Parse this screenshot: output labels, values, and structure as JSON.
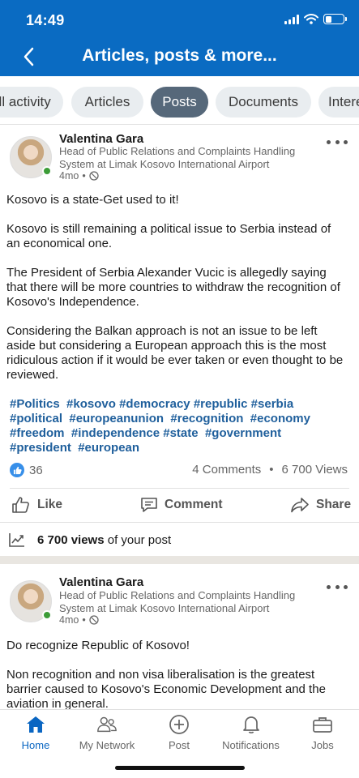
{
  "status_bar": {
    "time": "14:49"
  },
  "header": {
    "title": "Articles, posts & more..."
  },
  "filters": [
    {
      "label": "All activity",
      "active": false
    },
    {
      "label": "Articles",
      "active": false
    },
    {
      "label": "Posts",
      "active": true
    },
    {
      "label": "Documents",
      "active": false
    },
    {
      "label": "Interests",
      "active": false
    }
  ],
  "posts": [
    {
      "author": "Valentina Gara",
      "headline": "Head of Public Relations and Complaints Handling System at Limak Kosovo International Airport",
      "age": "4mo",
      "paragraphs": [
        "Kosovo is a state-Get used to it!",
        "Kosovo is still remaining a political issue to Serbia instead of an economical one.",
        "The President of Serbia Alexander Vucic is allegedly saying that there will be more countries to withdraw the recognition of Kosovo's Independence.",
        "Considering the Balkan approach is not an issue to be left aside but considering a European approach this is the most ridiculous action if it would be ever taken or even thought to be reviewed."
      ],
      "hashtags": [
        "#Politics",
        "#kosovo",
        "#democracy",
        "#republic",
        "#serbia",
        "#political",
        "#europeanunion",
        "#recognition",
        "#economy",
        "#freedom",
        "#independence",
        "#state",
        "#government",
        "#president",
        "#european"
      ],
      "reactions": "36",
      "comments": "4 Comments",
      "views_count": "6 700 Views",
      "actions": {
        "like": "Like",
        "comment": "Comment",
        "share": "Share"
      },
      "views_highlight": "6 700 views",
      "views_suffix": "of your post"
    },
    {
      "author": "Valentina Gara",
      "headline": "Head of Public Relations and Complaints Handling System at Limak Kosovo International Airport",
      "age": "4mo",
      "paragraphs": [
        "Do recognize Republic of Kosovo!",
        "Non recognition and non visa liberalisation is the greatest barrier caused to Kosovo's Economic Development and the aviation in general."
      ]
    }
  ],
  "bottom_nav": [
    {
      "label": "Home",
      "icon": "home-icon",
      "active": true
    },
    {
      "label": "My Network",
      "icon": "network-icon",
      "active": false
    },
    {
      "label": "Post",
      "icon": "plus-circle-icon",
      "active": false
    },
    {
      "label": "Notifications",
      "icon": "bell-icon",
      "active": false
    },
    {
      "label": "Jobs",
      "icon": "briefcase-icon",
      "active": false
    }
  ],
  "colors": {
    "brand": "#0a6bc2",
    "pill_active": "#56687a",
    "hashtag": "#1f5f9c",
    "like": "#378fe9",
    "online": "#3c9c37"
  }
}
